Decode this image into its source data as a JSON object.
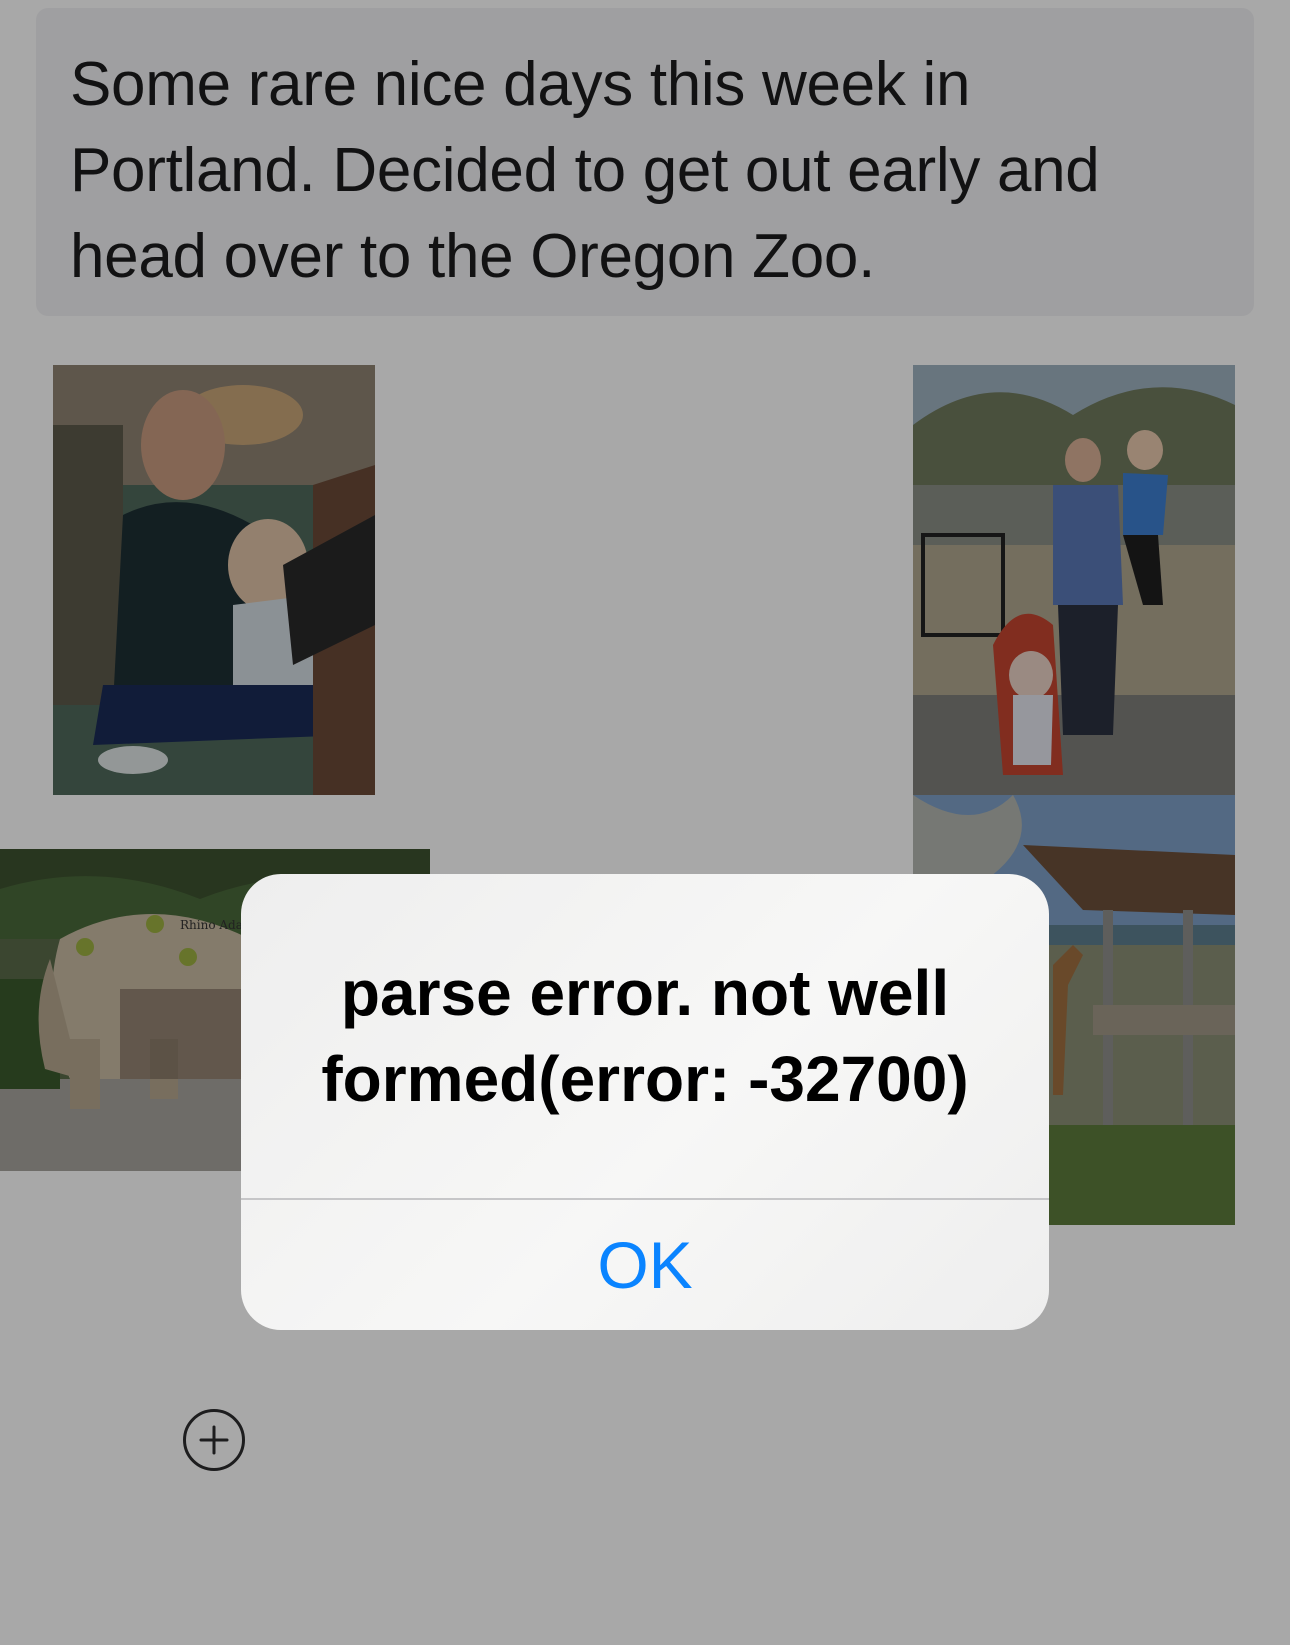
{
  "post": {
    "text": "Some rare nice days this week in Portland. Decided to get out early and head over to the Oregon Zoo."
  },
  "photos": {
    "photo1_icon": "photo-woman-baby-stroller",
    "photo2_icon": "photo-man-child-stroller",
    "photo3_icon": "photo-rhino-statue",
    "photo3_sign": "Rhino Adaptati",
    "photo4_icon": "photo-giraffe-shelter"
  },
  "add_button": {
    "icon": "plus-circle-icon"
  },
  "alert": {
    "message": "parse error. not well formed(error: -32700)",
    "ok_label": "OK",
    "accent_color": "#0a84ff"
  }
}
